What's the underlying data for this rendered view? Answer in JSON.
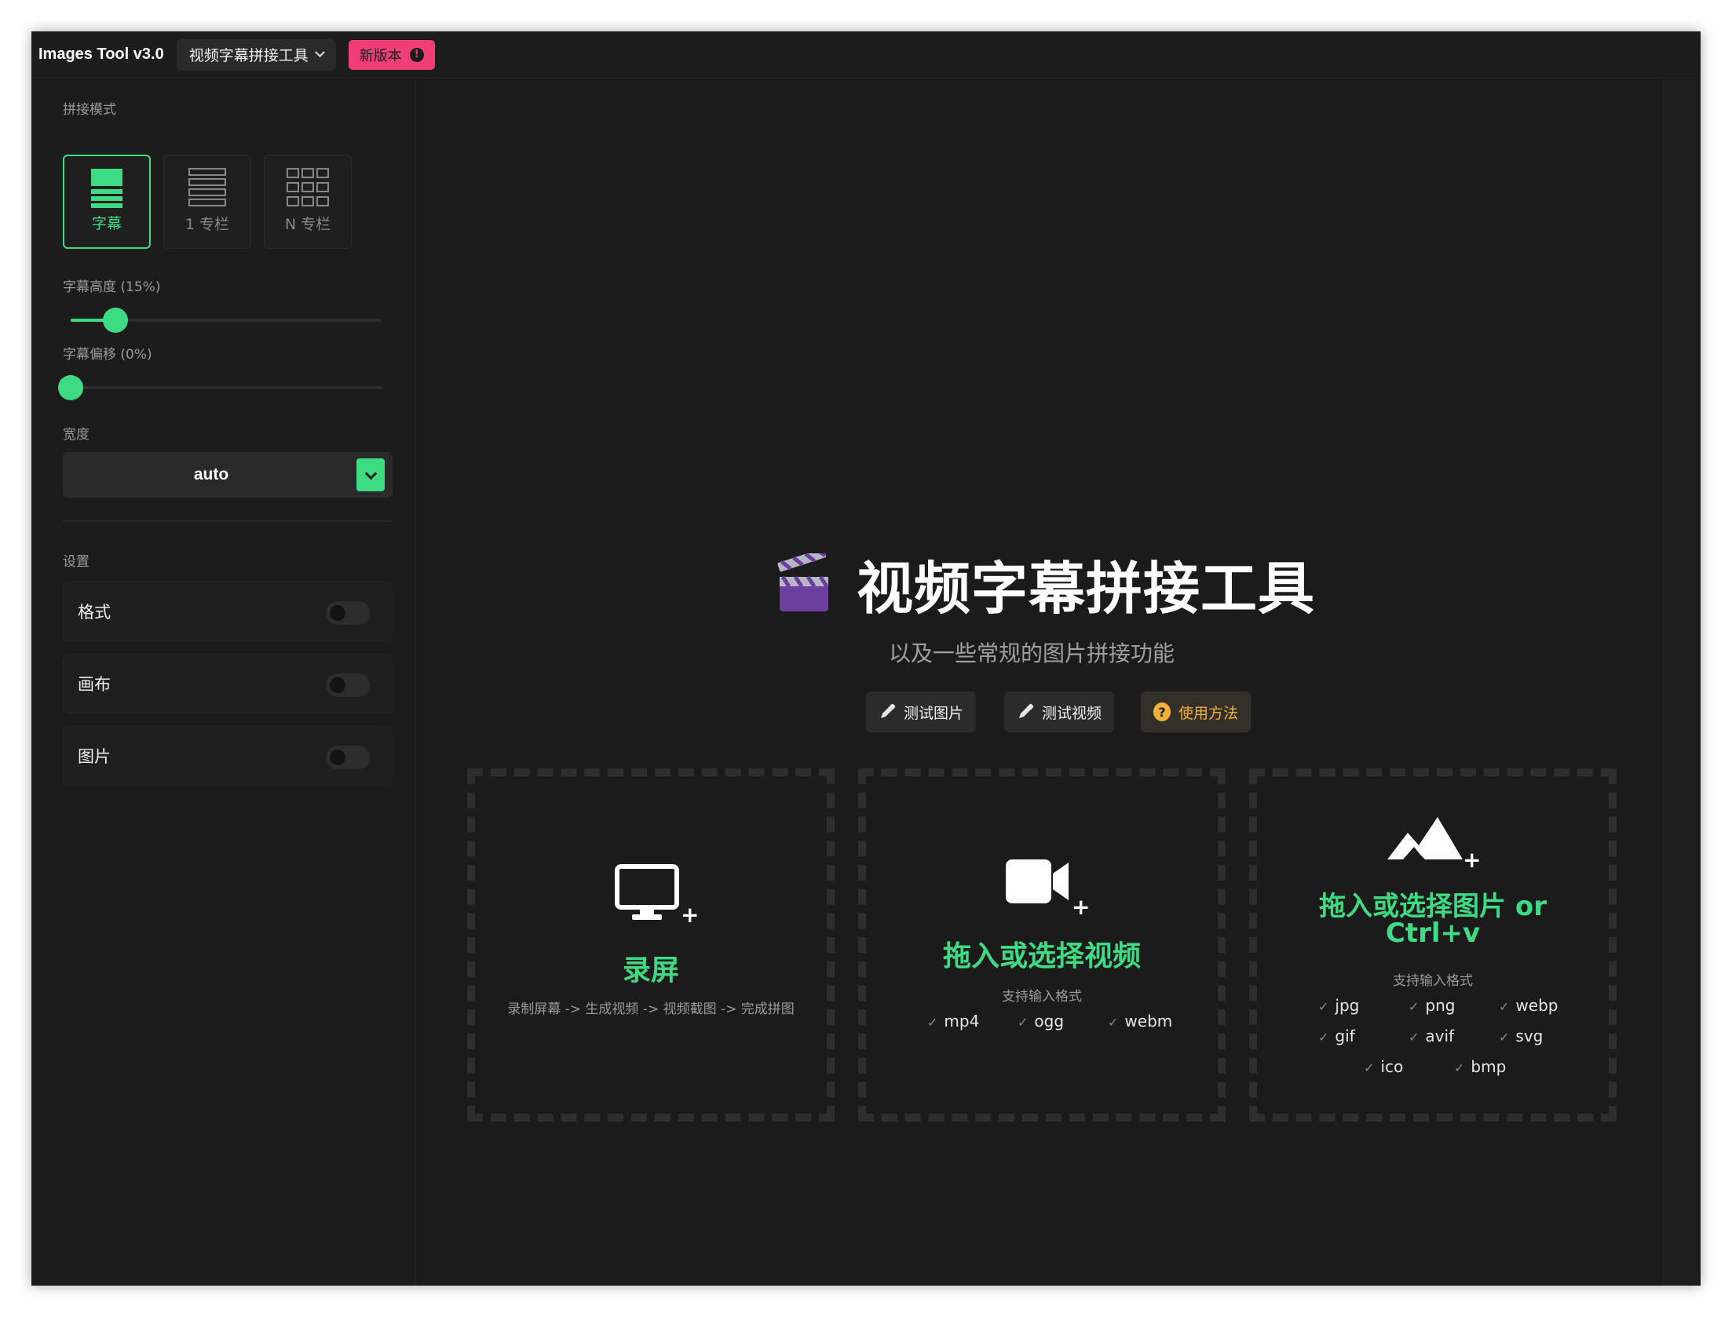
{
  "app": {
    "title": "Images Tool v3.0",
    "tool_select": "视频字幕拼接工具",
    "new_badge": "新版本",
    "new_badge_icon": "!"
  },
  "sidebar": {
    "mode_label": "拼接模式",
    "modes": [
      {
        "label": "字幕",
        "icon": "subtitle-stack-icon",
        "active": true
      },
      {
        "label": "1 专栏",
        "icon": "single-column-icon",
        "active": false
      },
      {
        "label": "N 专栏",
        "icon": "grid-columns-icon",
        "active": false
      }
    ],
    "subtitle_height": {
      "label": "字幕高度 (15%)",
      "value": 0.15
    },
    "subtitle_offset": {
      "label": "字幕偏移 (0%)",
      "value": 0.0
    },
    "width": {
      "label": "宽度",
      "value": "auto"
    },
    "settings_label": "设置",
    "toggles": [
      {
        "label": "格式",
        "on": false
      },
      {
        "label": "画布",
        "on": false
      },
      {
        "label": "图片",
        "on": false
      }
    ]
  },
  "main": {
    "title": "视频字幕拼接工具",
    "title_icon": "clapperboard-icon",
    "subtitle": "以及一些常规的图片拼接功能",
    "buttons": {
      "test_images": "测试图片",
      "test_video": "测试视频",
      "how_to_use": "使用方法"
    },
    "dropzones": {
      "record": {
        "icon": "monitor-icon",
        "plus": "+",
        "title": "录屏",
        "desc": "录制屏幕 -> 生成视频 -> 视频截图 -> 完成拼图"
      },
      "video": {
        "icon": "video-camera-icon",
        "plus": "+",
        "title": "拖入或选择视频",
        "formats_label": "支持输入格式",
        "formats": [
          "mp4",
          "ogg",
          "webm"
        ]
      },
      "image": {
        "icon": "mountain-image-icon",
        "plus": "+",
        "title_line1": "拖入或选择图片 or",
        "title_line2": "Ctrl+v",
        "formats_label": "支持输入格式",
        "formats": [
          "jpg",
          "png",
          "webp",
          "gif",
          "avif",
          "svg",
          "ico",
          "bmp"
        ]
      }
    }
  },
  "colors": {
    "accent": "#3ddc84",
    "badge": "#ef3f74",
    "help": "#f0b23a",
    "background": "#1b1b1b"
  }
}
